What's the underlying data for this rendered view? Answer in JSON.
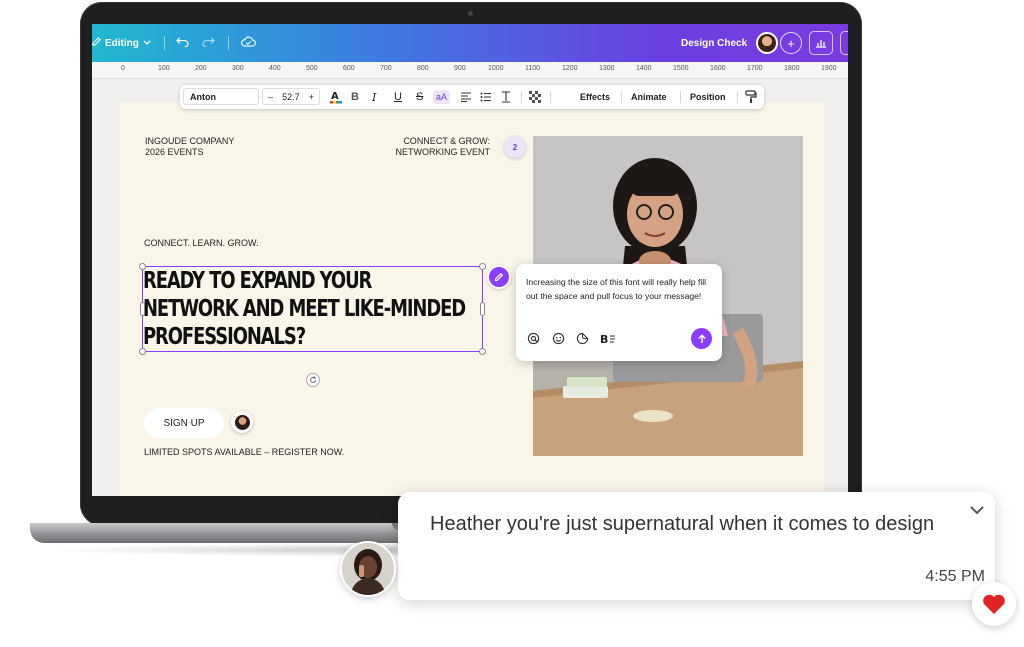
{
  "topbar": {
    "editing_label": "Editing",
    "design_check_label": "Design Check",
    "add_label": "+"
  },
  "ruler": {
    "ticks": [
      "0",
      "100",
      "200",
      "300",
      "400",
      "500",
      "600",
      "700",
      "800",
      "900",
      "1000",
      "1100",
      "1200",
      "1300",
      "1400",
      "1500",
      "1600",
      "1700",
      "1800",
      "1900"
    ]
  },
  "text_toolbar": {
    "font_name": "Anton",
    "font_size": "52.7",
    "minus": "–",
    "plus": "+",
    "bold": "B",
    "italic": "I",
    "underline": "U",
    "strike": "S",
    "case": "aA",
    "effects": "Effects",
    "animate": "Animate",
    "position": "Position"
  },
  "design": {
    "company": "INGOUDE COMPANY",
    "events": "2026 EVENTS",
    "connect_grow": "CONNECT & GROW:",
    "networking_event": "NETWORKING EVENT",
    "tagline": "CONNECT. LEARN. GROW.",
    "headline_1": "READY TO EXPAND YOUR",
    "headline_2": "NETWORK AND MEET LIKE-MINDED",
    "headline_3": "PROFESSIONALS?",
    "signup": "SIGN UP",
    "limited": "LIMITED SPOTS AVAILABLE – REGISTER NOW."
  },
  "comment": {
    "pin_count": "2",
    "text": "Increasing the size of this font will really help fill out the space and pull focus to your message!"
  },
  "chat": {
    "message": "Heather you're just supernatural when it comes to design",
    "time": "4:55 PM"
  },
  "colors": {
    "accent": "#8b3dff",
    "canvas_bg": "#faf5e9",
    "heart": "#e02424"
  }
}
